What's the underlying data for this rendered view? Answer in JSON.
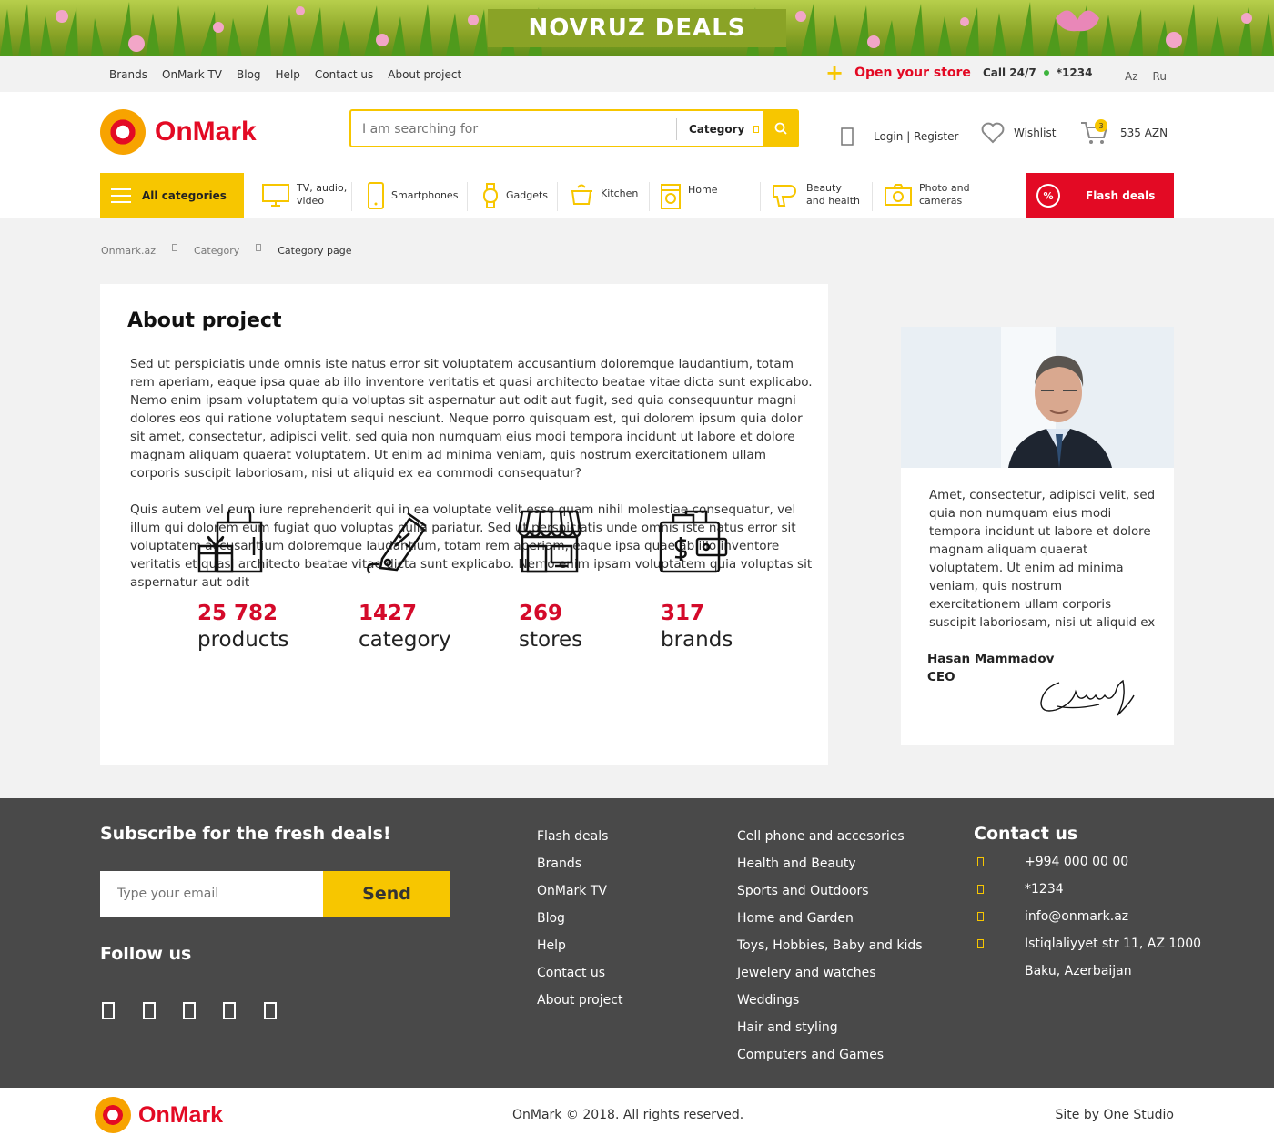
{
  "promo": {
    "title": "NOVRUZ DEALS"
  },
  "topbar": {
    "links": [
      "Brands",
      "OnMark TV",
      "Blog",
      "Help",
      "Contact us",
      "About project"
    ],
    "open_store": "Open your store",
    "call_label": "Call 24/7",
    "call_number": "*1234",
    "languages": [
      "Az",
      "Ru"
    ]
  },
  "header": {
    "logo_text": "OnMark",
    "search_placeholder": "I am searching for",
    "category_label": "Category",
    "login_register": "Login | Register",
    "wishlist": "Wishlist",
    "cart_count": "3",
    "cart_total": "535 AZN"
  },
  "catnav": {
    "all_categories": "All categories",
    "items": [
      {
        "label": "TV, audio, video",
        "icon": "tv-icon"
      },
      {
        "label": "Smartphones",
        "icon": "smartphone-icon"
      },
      {
        "label": "Gadgets",
        "icon": "smartwatch-icon"
      },
      {
        "label": "Kitchen",
        "icon": "pot-icon"
      },
      {
        "label": "Home",
        "icon": "washing-machine-icon"
      },
      {
        "label": "Beauty and health",
        "icon": "hair-dryer-icon"
      },
      {
        "label": "Photo and cameras",
        "icon": "camera-icon"
      }
    ],
    "flash_deals": "Flash deals"
  },
  "breadcrumbs": [
    "Onmark.az",
    "Category",
    "Category page"
  ],
  "about": {
    "title": "About project",
    "paragraphs": [
      "Sed ut perspiciatis unde omnis iste natus error sit voluptatem accusantium doloremque laudantium, totam rem aperiam, eaque ipsa quae ab illo inventore veritatis et quasi architecto beatae vitae dicta sunt explicabo. Nemo enim ipsam voluptatem quia voluptas sit aspernatur aut odit aut fugit, sed quia consequuntur magni dolores eos qui ratione voluptatem sequi nesciunt. Neque porro quisquam est, qui dolorem ipsum quia dolor sit amet, consectetur, adipisci velit, sed quia non numquam eius modi tempora incidunt ut labore et dolore magnam aliquam quaerat voluptatem. Ut enim ad minima veniam, quis nostrum exercitationem ullam corporis suscipit laboriosam, nisi ut aliquid ex ea commodi consequatur?",
      "Quis autem vel eum iure reprehenderit qui in ea voluptate velit esse quam nihil molestiae consequatur, vel illum qui dolorem eum fugiat quo voluptas nulla pariatur. Sed ut perspiciatis unde omnis iste natus error sit voluptatem accusantium doloremque laudantium, totam rem aperiam, eaque ipsa quae ab illo inventore veritatis et quasi architecto beatae vitae dicta sunt explicabo. Nemo enim ipsam voluptatem quia voluptas sit aspernatur aut odit"
    ],
    "stats": [
      {
        "value": "25 782",
        "label": "products",
        "icon": "shopping-bag-gift-icon"
      },
      {
        "value": "1427",
        "label": "category",
        "icon": "price-tag-icon"
      },
      {
        "value": "269",
        "label": "stores",
        "icon": "storefront-icon"
      },
      {
        "value": "317",
        "label": "brands",
        "icon": "wallet-icon"
      }
    ]
  },
  "ceo": {
    "quote": "Amet, consectetur, adipisci velit, sed quia non numquam eius modi tempora incidunt ut labore et dolore magnam aliquam quaerat voluptatem. Ut enim ad minima veniam, quis nostrum exercitationem ullam corporis suscipit laboriosam, nisi ut aliquid ex",
    "name": "Hasan Mammadov",
    "role": "CEO"
  },
  "footer": {
    "subscribe_title": "Subscribe for the fresh deals!",
    "email_placeholder": "Type your email",
    "send_label": "Send",
    "follow_title": "Follow us",
    "socials": [
      "facebook-icon",
      "instagram-icon",
      "twitter-icon",
      "youtube-icon",
      "linkedin-icon"
    ],
    "links": [
      "Flash deals",
      "Brands",
      "OnMark TV",
      "Blog",
      "Help",
      "Contact us",
      "About project"
    ],
    "categories": [
      "Cell phone and accesories",
      "Health and Beauty",
      "Sports and Outdoors",
      "Home and Garden",
      "Toys, Hobbies, Baby and kids",
      "Jewelery and watches",
      "Weddings",
      "Hair and styling",
      "Computers and Games"
    ],
    "contact_title": "Contact us",
    "contacts": {
      "phone": "+994 000 00 00",
      "short": "*1234",
      "email": "info@onmark.az",
      "address1": "Istiqlaliyyet str 11, AZ 1000",
      "address2": "Baku, Azerbaijan"
    }
  },
  "bottom": {
    "logo_text": "OnMark",
    "copyright": "OnMark © 2018. All rights reserved.",
    "credit": "Site by One Studio"
  },
  "colors": {
    "brand_red": "#e30a24",
    "accent_yellow": "#f7c600",
    "stat_red": "#d40a2a",
    "footer_bg": "#494949"
  }
}
